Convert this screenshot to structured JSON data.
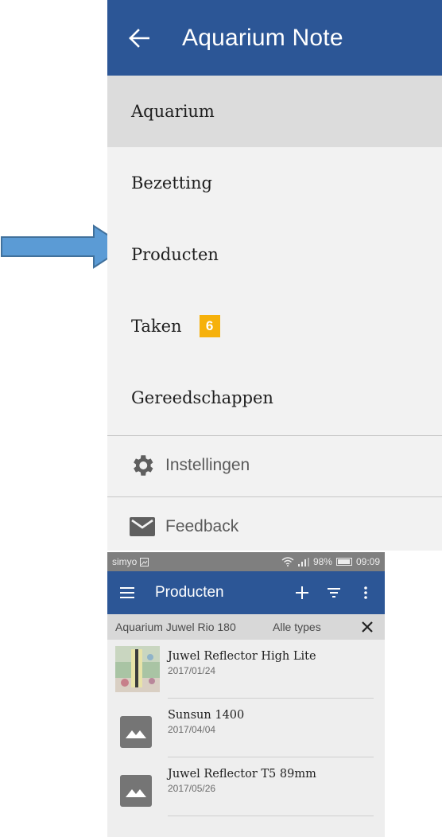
{
  "colors": {
    "primary": "#2c5696",
    "badge": "#f6b10b",
    "arrow_fill": "#5b9bd5",
    "arrow_stroke": "#41719c"
  },
  "drawer": {
    "title": "Aquarium Note",
    "back_icon": "arrow-left-icon",
    "items": [
      {
        "label": "Aquarium",
        "active": true
      },
      {
        "label": "Bezetting",
        "active": false
      },
      {
        "label": "Producten",
        "active": false
      },
      {
        "label": "Taken",
        "active": false,
        "badge": "6"
      },
      {
        "label": "Gereedschappen",
        "active": false
      }
    ],
    "secondary": [
      {
        "label": "Instellingen",
        "icon": "gear-icon"
      },
      {
        "label": "Feedback",
        "icon": "mail-icon"
      }
    ]
  },
  "annotation": {
    "icon": "right-arrow-icon",
    "points_to": "Producten"
  },
  "products_screen": {
    "status": {
      "carrier": "simyo",
      "battery": "98%",
      "time": "09:09"
    },
    "title": "Producten",
    "icons": {
      "menu": "hamburger-icon",
      "add": "plus-icon",
      "filter": "filter-icon",
      "more": "more-vert-icon",
      "close": "close-icon"
    },
    "filter": {
      "aquarium": "Aquarium Juwel Rio 180",
      "type": "Alle types"
    },
    "products": [
      {
        "name": "Juwel Reflector High Lite",
        "date": "2017/01/24",
        "thumb": "photo"
      },
      {
        "name": "Sunsun 1400",
        "date": "2017/04/04",
        "thumb": "image-placeholder-icon"
      },
      {
        "name": "Juwel Reflector T5 89mm",
        "date": "2017/05/26",
        "thumb": "image-placeholder-icon"
      }
    ]
  }
}
